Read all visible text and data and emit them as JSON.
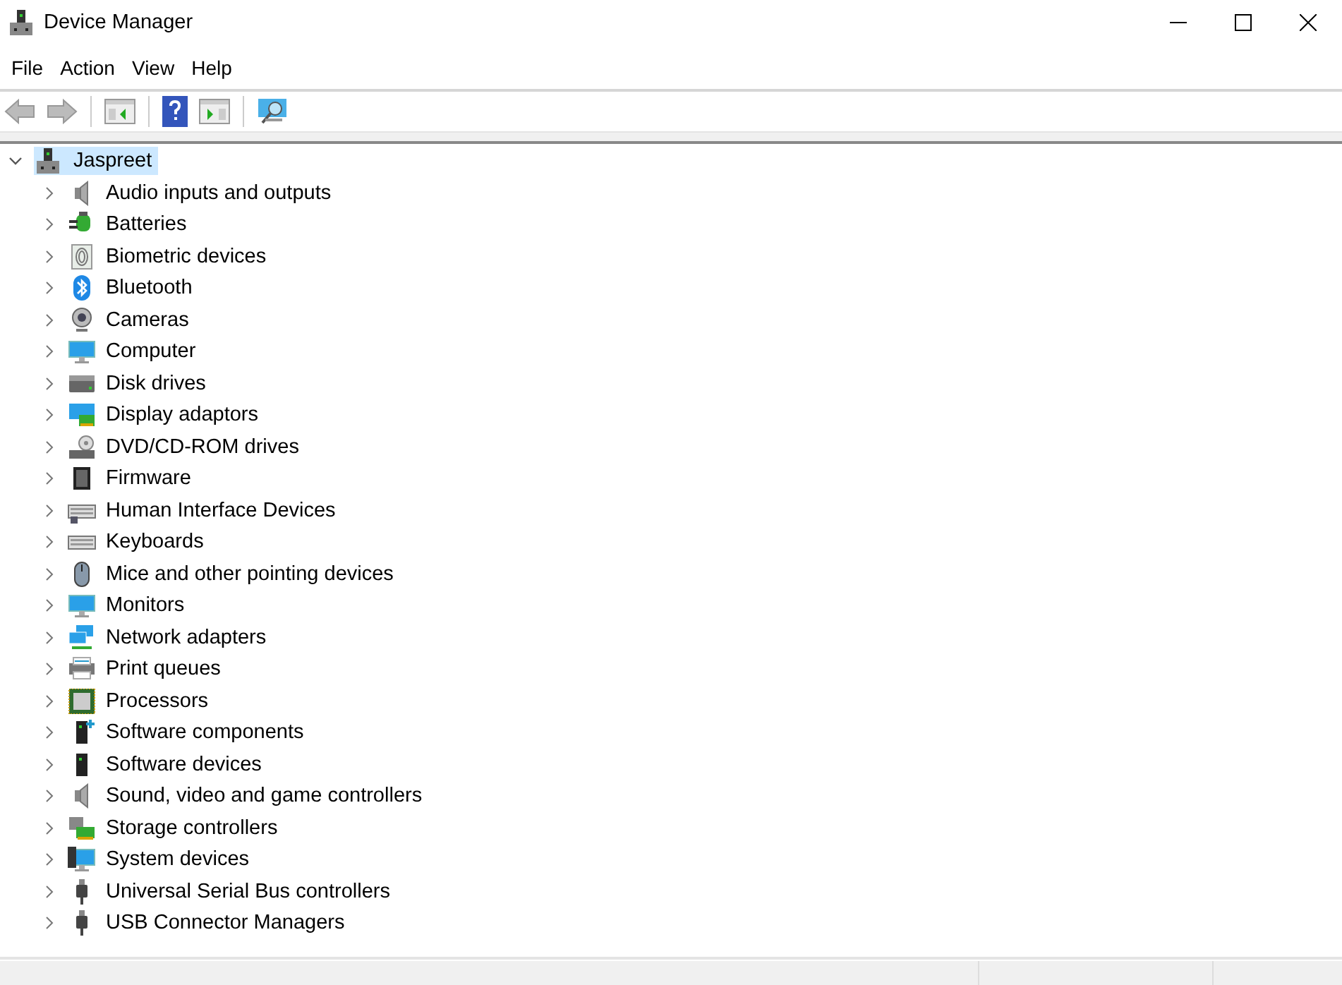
{
  "window": {
    "title": "Device Manager"
  },
  "menu": [
    "File",
    "Action",
    "View",
    "Help"
  ],
  "tree": {
    "label": "Jaspreet",
    "expanded": true,
    "selected": true,
    "children": [
      {
        "label": "Audio inputs and outputs",
        "expanded": false
      },
      {
        "label": "Batteries",
        "expanded": false
      },
      {
        "label": "Biometric devices",
        "expanded": false
      },
      {
        "label": "Bluetooth",
        "expanded": false
      },
      {
        "label": "Cameras",
        "expanded": false
      },
      {
        "label": "Computer",
        "expanded": false
      },
      {
        "label": "Disk drives",
        "expanded": false
      },
      {
        "label": "Display adaptors",
        "expanded": false
      },
      {
        "label": "DVD/CD-ROM drives",
        "expanded": false
      },
      {
        "label": "Firmware",
        "expanded": false
      },
      {
        "label": "Human Interface Devices",
        "expanded": false
      },
      {
        "label": "Keyboards",
        "expanded": false
      },
      {
        "label": "Mice and other pointing devices",
        "expanded": false
      },
      {
        "label": "Monitors",
        "expanded": false
      },
      {
        "label": "Network adapters",
        "expanded": false
      },
      {
        "label": "Print queues",
        "expanded": false
      },
      {
        "label": "Processors",
        "expanded": false
      },
      {
        "label": "Software components",
        "expanded": false
      },
      {
        "label": "Software devices",
        "expanded": false
      },
      {
        "label": "Sound, video and game controllers",
        "expanded": false
      },
      {
        "label": "Storage controllers",
        "expanded": false
      },
      {
        "label": "System devices",
        "expanded": false
      },
      {
        "label": "Universal Serial Bus controllers",
        "expanded": false
      },
      {
        "label": "USB Connector Managers",
        "expanded": false
      }
    ]
  }
}
